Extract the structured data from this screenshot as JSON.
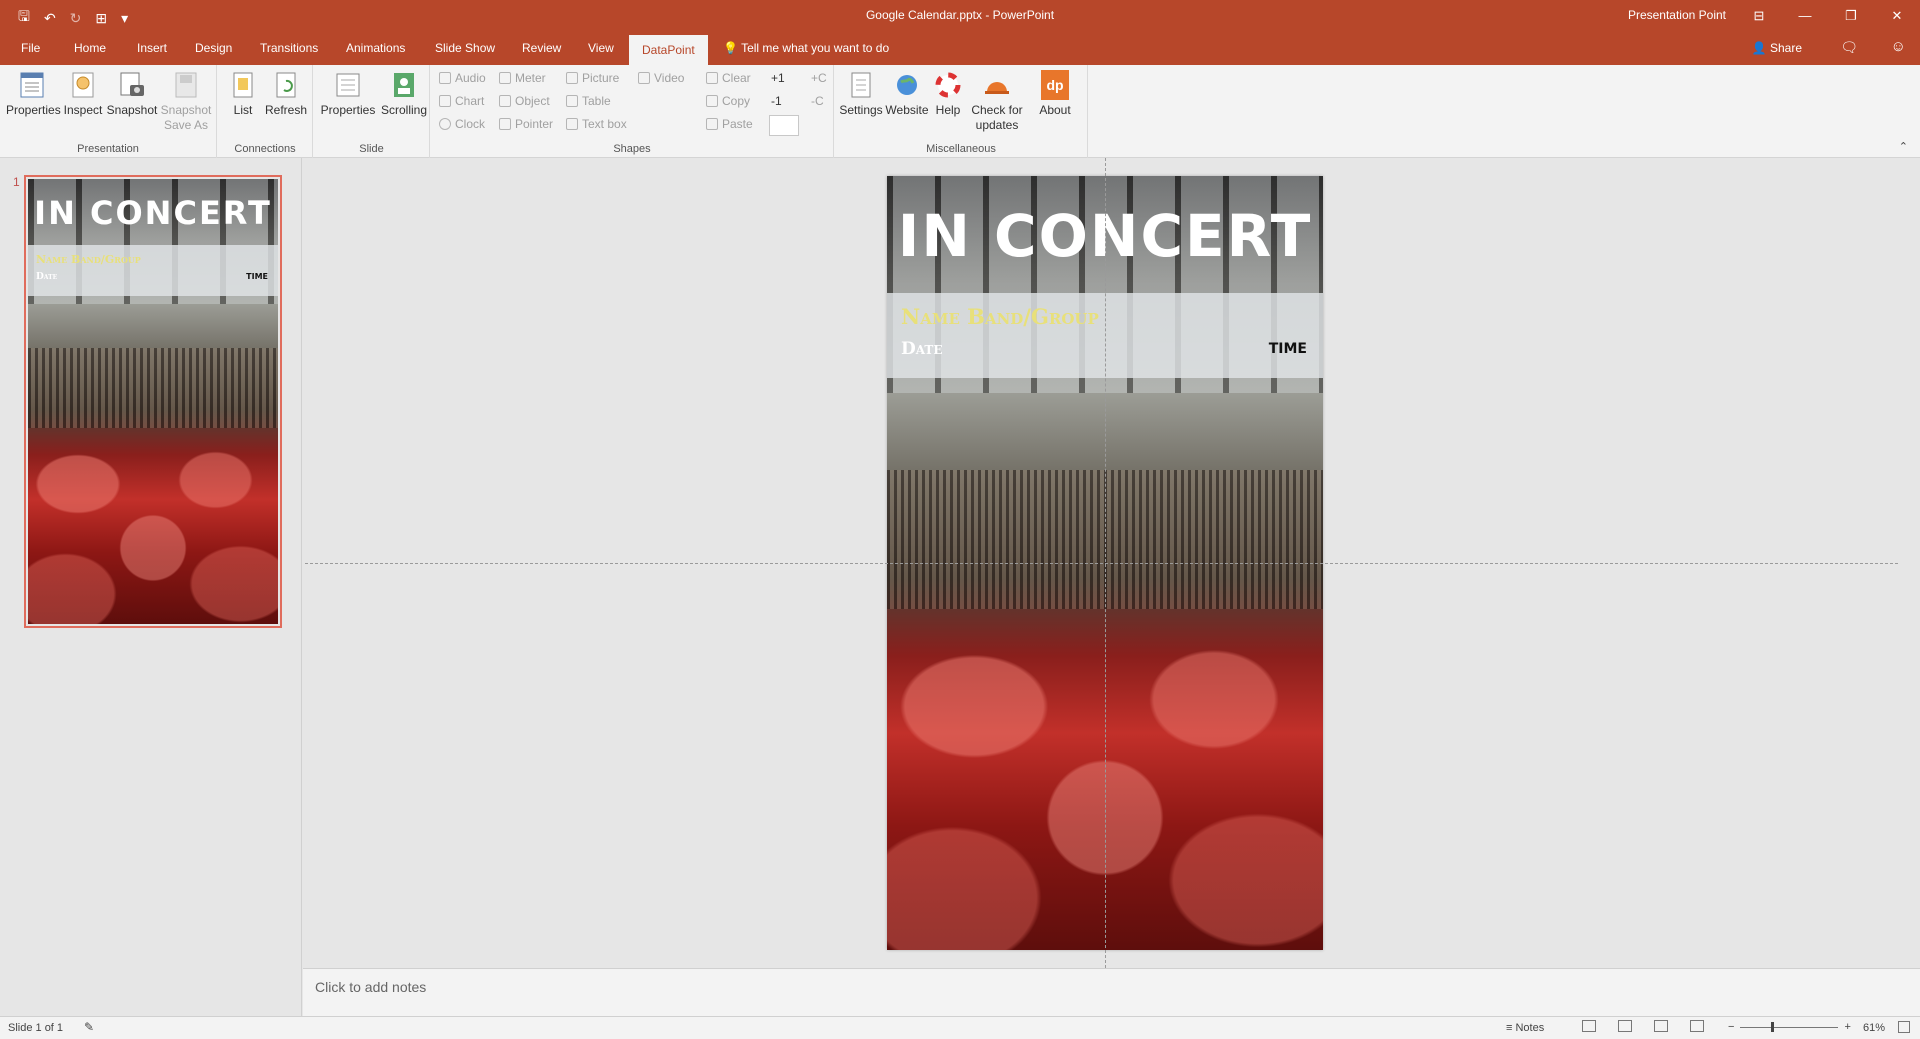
{
  "window": {
    "title": "Google Calendar.pptx - PowerPoint",
    "user": "Presentation Point",
    "controls": [
      "⊟",
      "—",
      "❐",
      "✕"
    ]
  },
  "qat": {
    "save": "🖫",
    "undo": "↶",
    "redo": "↻",
    "present": "⊞",
    "customize": "▾"
  },
  "tabs": [
    "File",
    "Home",
    "Insert",
    "Design",
    "Transitions",
    "Animations",
    "Slide Show",
    "Review",
    "View",
    "DataPoint"
  ],
  "tell_me": "Tell me what you want to do",
  "share": "Share",
  "ribbon": {
    "presentation": {
      "label": "Presentation",
      "buttons": [
        "Properties",
        "Inspect",
        "Snapshot",
        "Snapshot Save As"
      ]
    },
    "connections": {
      "label": "Connections",
      "buttons": [
        "List",
        "Refresh"
      ]
    },
    "slide": {
      "label": "Slide",
      "buttons": [
        "Properties",
        "Scrolling"
      ]
    },
    "shapes": {
      "label": "Shapes",
      "col1": [
        "Audio",
        "Chart",
        "Clock"
      ],
      "col2": [
        "Meter",
        "Object",
        "Pointer"
      ],
      "col3": [
        "Picture",
        "Table",
        "Text box"
      ],
      "col4": [
        "Video"
      ],
      "col5": [
        "Clear",
        "Copy",
        "Paste"
      ],
      "col6": [
        "+1",
        "-1"
      ],
      "col7": [
        "+C",
        "-C"
      ]
    },
    "misc": {
      "label": "Miscellaneous",
      "buttons": [
        "Settings",
        "Website",
        "Help",
        "Check for updates",
        "About"
      ],
      "about_logo": "dp"
    }
  },
  "thumbnail": {
    "number": "1"
  },
  "slide": {
    "title": "IN CONCERT",
    "band": "Name Band/Group",
    "date": "Date",
    "time": "TIME"
  },
  "notes_placeholder": "Click to add notes",
  "status": {
    "slide_info": "Slide 1 of 1",
    "notes": "Notes",
    "zoom": "61%",
    "zoom_level": 0.61
  },
  "colors": {
    "accent": "#b7472a",
    "band_name": "#e8e07a"
  }
}
